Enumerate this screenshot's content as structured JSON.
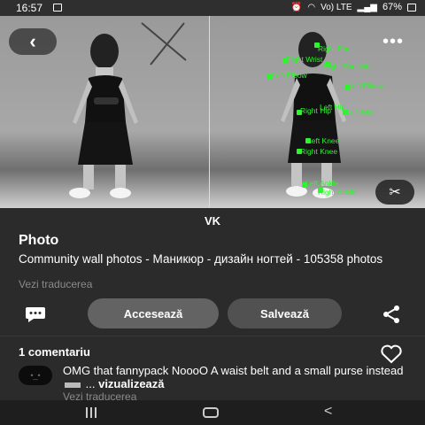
{
  "status": {
    "time": "16:57",
    "network": "Vo) LTE",
    "battery": "67%"
  },
  "photo": {
    "pose_labels": [
      "Right Ear",
      "Right Wrist",
      "Right Shoulder",
      "Left Elbow",
      "Left Elbow",
      "Right Hip",
      "Left Hip",
      "Left Wrist",
      "Left Knee",
      "Right Knee",
      "Left Ankle",
      "Right Ankle"
    ]
  },
  "header": {
    "source": "VK"
  },
  "pin": {
    "title": "Photo",
    "description": "Community wall photos - Маникюр - дизайн ногтей - 105358 photos",
    "translate": "Vezi traducerea"
  },
  "actions": {
    "access": "Accesează",
    "save": "Salvează"
  },
  "comments": {
    "count_label": "1 comentariu",
    "items": [
      {
        "avatar_text": "•_•",
        "text_start": "OMG that fannypack NoooO A waist belt and a small purse instead",
        "text_end": "...",
        "more": "vizualizează",
        "translate": "Vezi traducerea"
      }
    ]
  }
}
